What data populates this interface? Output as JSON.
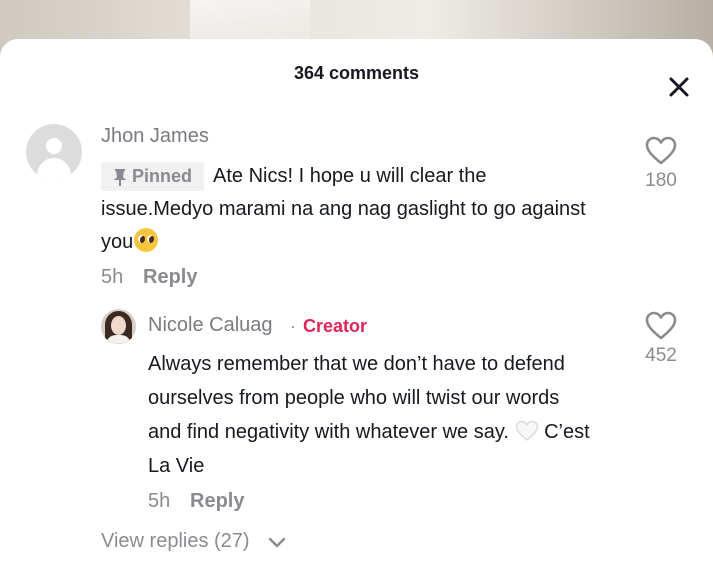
{
  "header": {
    "title": "364 comments"
  },
  "comments": [
    {
      "username": "Jhon James",
      "badge": "Pinned",
      "text_line1": "Ate Nics! I hope u will clear the",
      "text_line2": "issue.Medyo marami na ang nag gaslight to go against",
      "text_line3": "you",
      "emoji": "pleading-face",
      "time": "5h",
      "reply_label": "Reply",
      "likes": "180",
      "replies": [
        {
          "username": "Nicole Caluag",
          "separator": "·",
          "role": "Creator",
          "text_line1": "Always remember that we don’t have to defend",
          "text_line2": "ourselves from people who will twist our words",
          "text_line3a": "and find negativity with whatever we say.",
          "emoji": "white-heart",
          "text_line3b": "C’est",
          "text_line4": "La Vie",
          "time": "5h",
          "reply_label": "Reply",
          "likes": "452"
        }
      ],
      "view_replies_label": "View replies (27)"
    }
  ],
  "colors": {
    "creator_accent": "#e1245a",
    "muted_text": "#8a8b91",
    "primary_text": "#161823"
  },
  "icons": [
    "close-icon",
    "heart-outline-icon",
    "pin-icon",
    "chevron-down-icon"
  ]
}
